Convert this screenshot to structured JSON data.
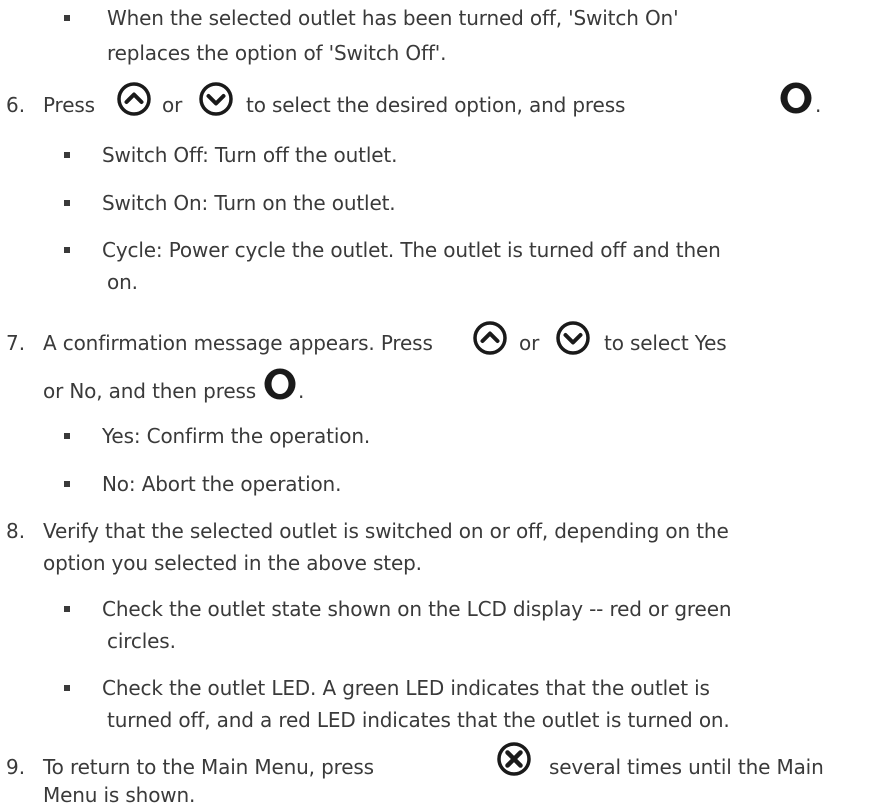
{
  "items": {
    "b0": {
      "lines": [
        "When the selected outlet has been turned off, 'Switch On'",
        "replaces the option of 'Switch Off'."
      ]
    },
    "s6": {
      "number": "6.",
      "parts": [
        "Press",
        "or",
        "to select the desired option, and press",
        "."
      ],
      "icons": [
        "chevron-up-circle-icon",
        "chevron-down-circle-icon",
        "ok-ring-icon"
      ],
      "bullets": [
        {
          "lines": [
            "Switch Off: Turn off the outlet."
          ]
        },
        {
          "lines": [
            "Switch On: Turn on the outlet."
          ]
        },
        {
          "lines": [
            "Cycle: Power cycle the outlet. The outlet is turned off and then",
            "on."
          ]
        }
      ]
    },
    "s7": {
      "number": "7.",
      "parts": [
        "A confirmation message appears. Press",
        "or",
        "to select Yes",
        "or No, and then press",
        "."
      ],
      "icons": [
        "chevron-up-circle-icon",
        "chevron-down-circle-icon",
        "ok-ring-icon"
      ],
      "bullets": [
        {
          "lines": [
            "Yes: Confirm the operation."
          ]
        },
        {
          "lines": [
            "No: Abort the operation."
          ]
        }
      ]
    },
    "s8": {
      "number": "8.",
      "lines": [
        "Verify that the selected outlet is switched on or off, depending on the",
        "option you selected in the above step."
      ],
      "bullets": [
        {
          "lines": [
            "Check the outlet state shown on the LCD display -- red or green",
            "circles."
          ]
        },
        {
          "lines": [
            "Check the outlet LED. A green LED indicates that the outlet is",
            "turned off, and a red LED indicates that the outlet is turned on."
          ]
        }
      ]
    },
    "s9": {
      "number": "9.",
      "parts": [
        "To return to the Main Menu, press",
        "several times until the Main",
        "Menu is shown."
      ],
      "icons": [
        "close-circle-icon"
      ]
    }
  },
  "colors": {
    "text": "#3a3a3a",
    "icon": "#1a1a1a"
  }
}
